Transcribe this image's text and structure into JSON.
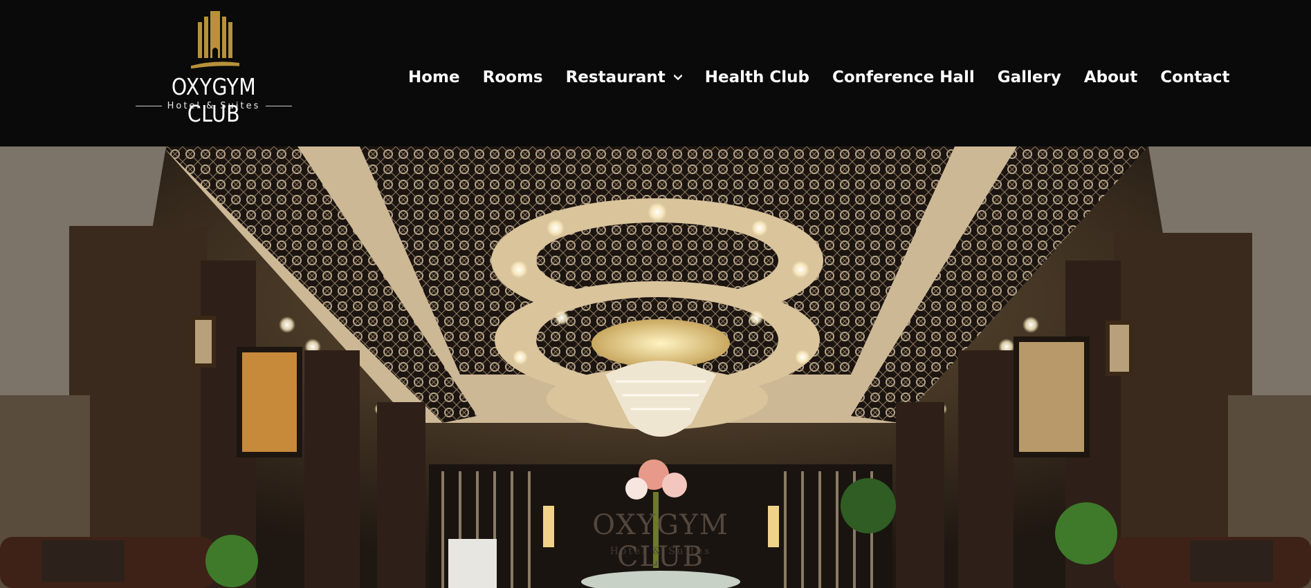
{
  "brand": {
    "name": "OXYGYM CLUB",
    "tagline": "Hotel & Suites",
    "logo_color": "#b8913a"
  },
  "nav": {
    "items": [
      {
        "label": "Home"
      },
      {
        "label": "Rooms"
      },
      {
        "label": "Restaurant",
        "has_dropdown": true,
        "icon": "chevron-down-icon"
      },
      {
        "label": "Health Club"
      },
      {
        "label": "Conference Hall"
      },
      {
        "label": "Gallery"
      },
      {
        "label": "About"
      },
      {
        "label": "Contact"
      }
    ]
  },
  "hero": {
    "image": "hotel-lobby-photo",
    "signage_text": "OXYGYM CLUB",
    "signage_subtext": "Hotel & Suites"
  },
  "colors": {
    "header_bg": "#0a0a0a",
    "nav_text": "#ffffff",
    "accent_gold": "#b8913a"
  }
}
